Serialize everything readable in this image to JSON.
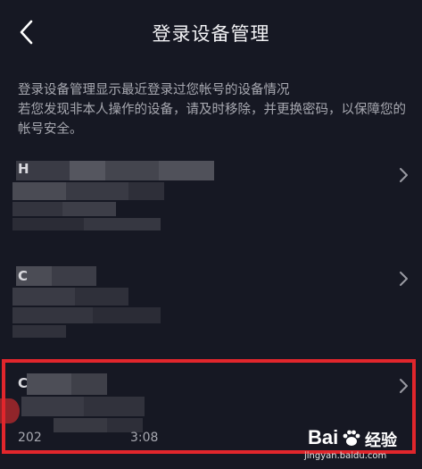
{
  "header": {
    "title": "登录设备管理",
    "back_icon": "chevron-left-icon"
  },
  "description": {
    "line1": "登录设备管理显示最近登录过您帐号的设备情况",
    "line2": "若您发现非本人操作的设备，请及时移除，并更换密码，以保障您的帐号安全。"
  },
  "devices": [
    {
      "name_fragment": "H",
      "date_fragment": ""
    },
    {
      "name_fragment": "C",
      "date_fragment": ""
    },
    {
      "name_fragment": "C",
      "date_prefix": "202",
      "date_suffix": "3:08"
    }
  ],
  "watermark": {
    "brand": "Bai",
    "brand_cn": "经验",
    "url": "jingyan.baidu.com"
  },
  "colors": {
    "background": "#161823",
    "highlight_border": "#e1262c",
    "muted_text": "#a7a8b0"
  }
}
